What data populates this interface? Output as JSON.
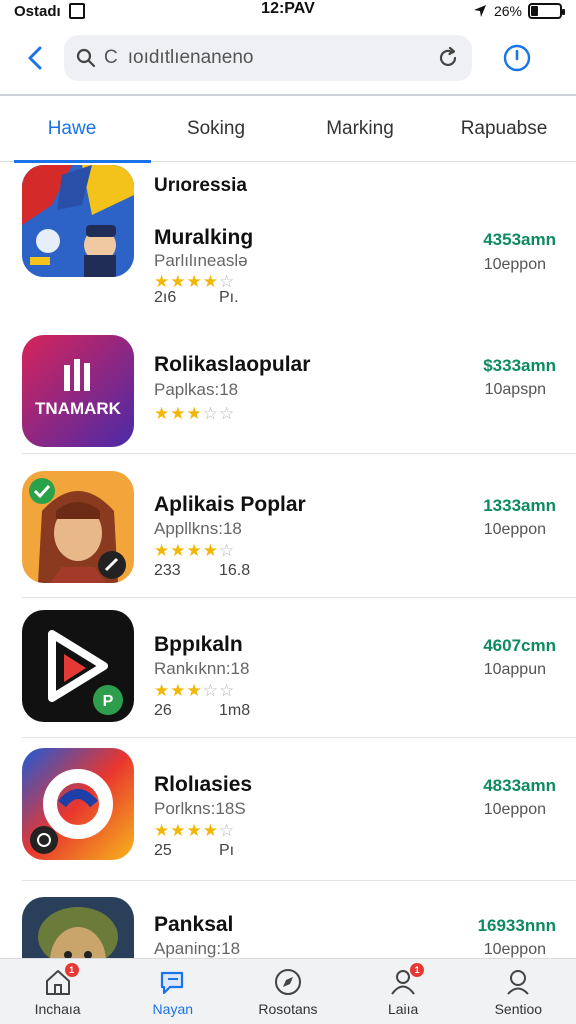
{
  "status_bar": {
    "carrier": "Ostadı",
    "time": "12:PAV",
    "battery": "26%",
    "battery_fraction": 0.26
  },
  "topbar": {
    "search_value": "ıoıdıtlıenaneno",
    "search_prefix": "C"
  },
  "tabs": [
    {
      "label": "Hawe",
      "active": true
    },
    {
      "label": "Soking",
      "active": false
    },
    {
      "label": "Marking",
      "active": false
    },
    {
      "label": "Rapuabse",
      "active": false
    }
  ],
  "section_label": "Urıoressia",
  "apps": [
    {
      "name": "Muralking",
      "subtitle": "Parlılıneaslə",
      "rating": 4,
      "meta_a": "2ı6",
      "meta_b": "Pı.",
      "price": "4353amn",
      "size": "10eppon",
      "colors": [
        "#1e5bb8",
        "#f3c31c",
        "#d42a2a"
      ]
    },
    {
      "name": "Rolikaslaopular",
      "subtitle": "Paplkas:18",
      "rating": 2.5,
      "meta_a": "",
      "meta_b": "",
      "price": "$333amn",
      "size": "10apspn",
      "colors": [
        "#c0225a",
        "#5b2aa8",
        "#ffffff"
      ],
      "icon_text": "TNAMARK"
    },
    {
      "name": "Aplikais Poplar",
      "subtitle": "Appllkns:18",
      "rating": 4,
      "meta_a": "233",
      "meta_b": "16.8",
      "price": "1333amn",
      "size": "10eppon",
      "colors": [
        "#f2a53b",
        "#8a3a1e",
        "#2aa24a"
      ]
    },
    {
      "name": "Bppıkaln",
      "subtitle": "Rankıknn:18",
      "rating": 3,
      "meta_a": "26",
      "meta_b": "1m8",
      "price": "4607cmn",
      "size": "10appun",
      "colors": [
        "#111111",
        "#e53935",
        "#2e9d4e"
      ]
    },
    {
      "name": "Rlolıasies",
      "subtitle": "Porlkns:18S",
      "rating": 4,
      "meta_a": "25",
      "meta_b": "Pı",
      "price": "4833amn",
      "size": "10eppon",
      "colors": [
        "#1e5bd8",
        "#e8362f",
        "#f7b51c"
      ]
    },
    {
      "name": "Panksal",
      "subtitle": "Apaning:18",
      "rating": 0,
      "meta_a": "",
      "meta_b": "",
      "price": "16933nnn",
      "size": "10eppon",
      "colors": [
        "#6b7b3a",
        "#2a3f5a",
        "#c9a46b"
      ]
    }
  ],
  "bottom_nav": [
    {
      "label": "Inchaıa",
      "icon": "home-icon",
      "badge": "1"
    },
    {
      "label": "Nayan",
      "icon": "chat-icon",
      "active": true
    },
    {
      "label": "Rosotans",
      "icon": "compass-icon"
    },
    {
      "label": "Laiıa",
      "icon": "person-icon",
      "badge": "1"
    },
    {
      "label": "Sentioo",
      "icon": "user-icon"
    }
  ],
  "accent_color": "#1a73e8",
  "price_color": "#0e8a5f"
}
